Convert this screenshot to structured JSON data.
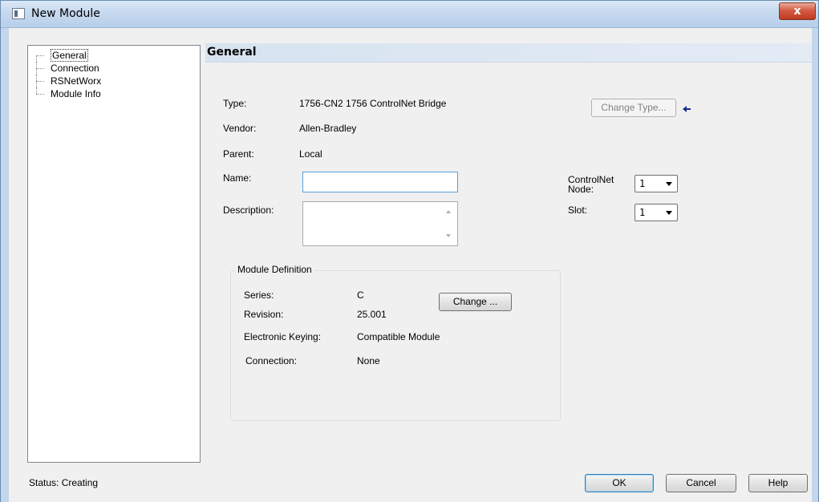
{
  "window": {
    "title": "New Module",
    "close_label": "x"
  },
  "tree": {
    "items": [
      {
        "label": "General"
      },
      {
        "label": "Connection"
      },
      {
        "label": "RSNetWorx"
      },
      {
        "label": "Module Info"
      }
    ]
  },
  "section": {
    "title": "General"
  },
  "fields": {
    "type_label": "Type:",
    "type_value": "1756-CN2 1756 ControlNet Bridge",
    "vendor_label": "Vendor:",
    "vendor_value": "Allen-Bradley",
    "parent_label": "Parent:",
    "parent_value": "Local",
    "name_label": "Name:",
    "name_value": "",
    "description_label": "Description:",
    "description_value": ""
  },
  "change_type_button": "Change Type...",
  "controlnet": {
    "node_label_1": "ControlNet",
    "node_label_2": "Node:",
    "node_value": "1",
    "slot_label": "Slot:",
    "slot_value": "1"
  },
  "module_definition": {
    "title": "Module Definition",
    "series_label": "Series:",
    "series_value": "C",
    "revision_label": "Revision:",
    "revision_value": "25.001",
    "keying_label": "Electronic Keying:",
    "keying_value": "Compatible Module",
    "connection_label": "Connection:",
    "connection_value": "None",
    "change_button": "Change ..."
  },
  "status": {
    "text": "Status:  Creating"
  },
  "buttons": {
    "ok": "OK",
    "cancel": "Cancel",
    "help": "Help"
  },
  "colors": {
    "titlebar": "#c6d9ef",
    "close": "#c0391f",
    "section_header": "#d7e3f1",
    "back_arrow": "#1a2e8a"
  },
  "icons": {
    "change_type_hint": "arrow-left-icon"
  }
}
